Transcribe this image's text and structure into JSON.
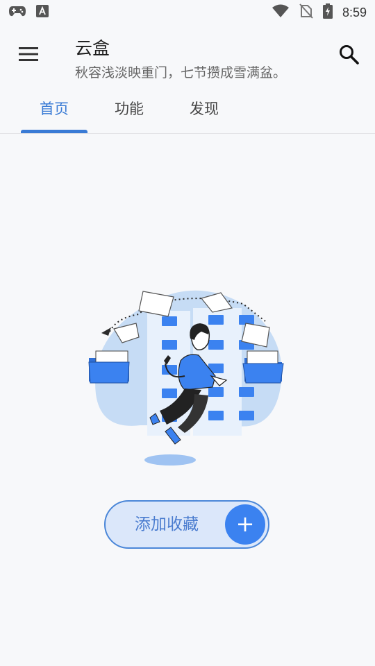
{
  "status_bar": {
    "time": "8:59",
    "left_icons": [
      "gamepad-icon",
      "font-a-icon"
    ],
    "right_icons": [
      "wifi-icon",
      "no-sim-icon",
      "battery-charging-icon"
    ]
  },
  "app_bar": {
    "title": "云盒",
    "subtitle": "秋容浅淡映重门，七节攒成雪满盆。",
    "menu_icon": "hamburger-menu-icon",
    "search_icon": "search-icon"
  },
  "tabs": [
    {
      "label": "首页",
      "active": true
    },
    {
      "label": "功能",
      "active": false
    },
    {
      "label": "发现",
      "active": false
    }
  ],
  "main": {
    "illustration": "empty-state-folders-illustration",
    "add_button": {
      "label": "添加收藏",
      "icon": "plus-icon",
      "plus_glyph": "+"
    }
  },
  "colors": {
    "accent": "#3a7bd5",
    "button_fill": "#dbe7fa",
    "plus_circle": "#3b82f0",
    "background": "#f7f8fa"
  }
}
